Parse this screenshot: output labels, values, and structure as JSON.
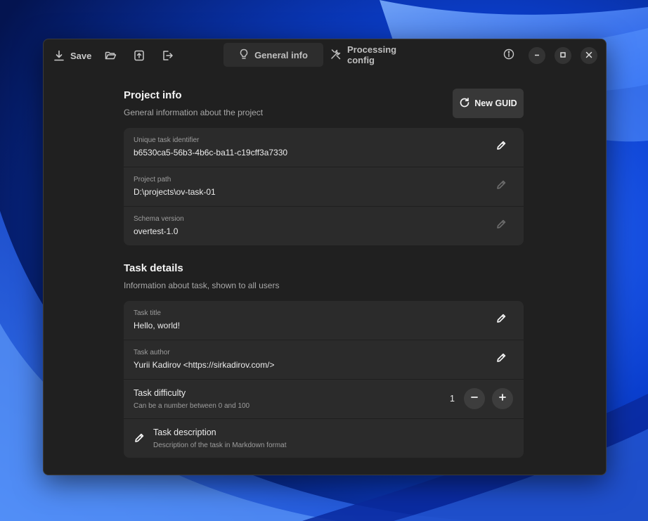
{
  "toolbar": {
    "save_label": "Save",
    "icons": [
      "download-icon",
      "folder-open-icon",
      "upload-icon",
      "exit-icon"
    ]
  },
  "tabs": [
    {
      "label": "General info",
      "icon": "lightbulb-icon",
      "active": true
    },
    {
      "label": "Processing config",
      "icon": "tools-icon",
      "active": false
    }
  ],
  "window_controls": [
    "info-icon",
    "minimize-icon",
    "maximize-icon",
    "close-icon"
  ],
  "project_info": {
    "title": "Project info",
    "subtitle": "General information about the project",
    "new_guid_label": "New GUID",
    "fields": [
      {
        "label": "Unique task identifier",
        "value": "b6530ca5-56b3-4b6c-ba11-c19cff3a7330",
        "editable": true
      },
      {
        "label": "Project path",
        "value": "D:\\projects\\ov-task-01",
        "editable": false
      },
      {
        "label": "Schema version",
        "value": "overtest-1.0",
        "editable": false
      }
    ]
  },
  "task_details": {
    "title": "Task details",
    "subtitle": "Information about task, shown to all users",
    "fields": [
      {
        "label": "Task title",
        "value": "Hello, world!",
        "editable": true
      },
      {
        "label": "Task author",
        "value": "Yurii Kadirov <https://sirkadirov.com/>",
        "editable": true
      }
    ],
    "difficulty": {
      "title": "Task difficulty",
      "hint": "Can be a number between 0 and 100",
      "value": "1"
    },
    "description": {
      "title": "Task description",
      "hint": "Description of the task in Markdown format"
    }
  },
  "colors": {
    "window_bg": "#202020",
    "card_bg": "#2b2b2b",
    "text": "#ececec",
    "muted": "#9d9d9d"
  }
}
